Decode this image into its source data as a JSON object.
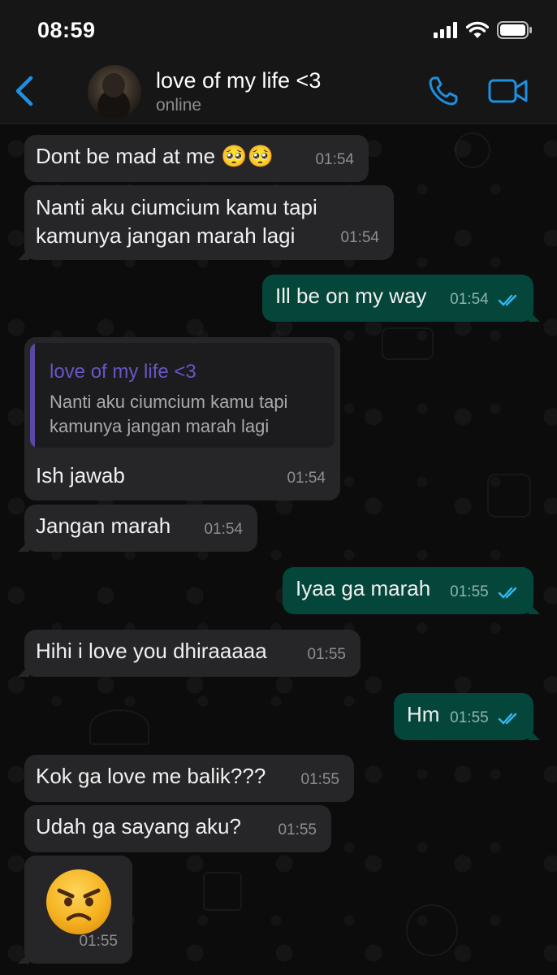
{
  "status_bar": {
    "time": "08:59"
  },
  "header": {
    "back_icon": "chevron-left-icon",
    "contact_name": "love of my life <3",
    "contact_status": "online",
    "call_icon": "phone-icon",
    "video_icon": "video-camera-icon"
  },
  "colors": {
    "accent": "#1f8fe0",
    "incoming_bubble": "#262628",
    "outgoing_bubble": "#05463a",
    "read_tick": "#34b7f1",
    "quote_name": "#6a55c2"
  },
  "messages": [
    {
      "dir": "in",
      "text": "Dont be mad at me 🥺🥺",
      "time": "01:54"
    },
    {
      "dir": "in",
      "text": "Nanti aku ciumcium kamu tapi kamunya jangan marah lagi",
      "time": "01:54"
    },
    {
      "dir": "out",
      "text": "Ill be on my way",
      "time": "01:54",
      "status": "read"
    },
    {
      "dir": "in",
      "reply_to": {
        "name": "love of my life <3",
        "text": "Nanti aku ciumcium kamu tapi kamunya jangan marah lagi"
      },
      "text": "Ish jawab",
      "time": "01:54"
    },
    {
      "dir": "in",
      "text": "Jangan marah",
      "time": "01:54"
    },
    {
      "dir": "out",
      "text": "Iyaa ga marah",
      "time": "01:55",
      "status": "read"
    },
    {
      "dir": "in",
      "text": "Hihi i love you dhiraaaaa",
      "time": "01:55"
    },
    {
      "dir": "out",
      "text": "Hm",
      "time": "01:55",
      "status": "read"
    },
    {
      "dir": "in",
      "text": "Kok ga love me balik???",
      "time": "01:55"
    },
    {
      "dir": "in",
      "text": "Udah ga sayang aku?",
      "time": "01:55"
    },
    {
      "dir": "in",
      "sticker": "angry-face-emoji",
      "time": "01:55"
    }
  ]
}
